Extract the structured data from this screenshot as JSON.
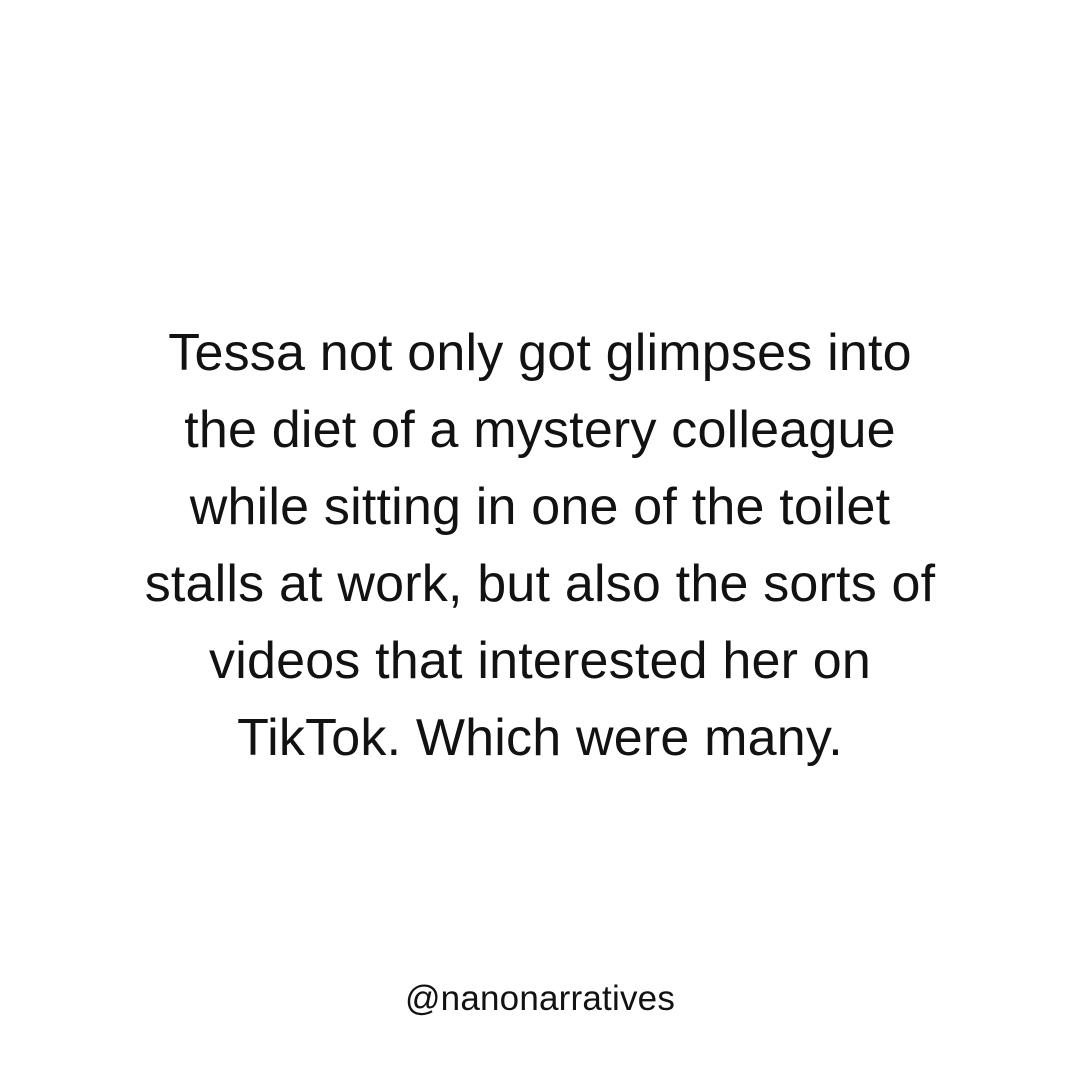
{
  "post": {
    "story_lines": [
      "Tessa not only got glimpses into",
      "the diet of a mystery colleague",
      "while sitting in one of the toilet",
      "stalls at work, but also the sorts of",
      "videos that interested her on",
      "TikTok. Which were many."
    ],
    "handle": "@nanonarratives"
  },
  "colors": {
    "background": "#ffffff",
    "text": "#121212"
  }
}
